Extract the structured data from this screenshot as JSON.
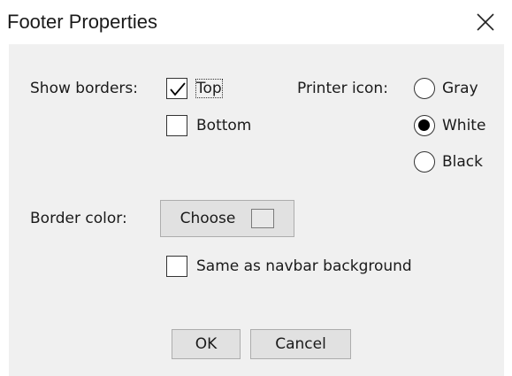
{
  "window": {
    "title": "Footer Properties",
    "close_icon": "close-icon"
  },
  "borders": {
    "label": "Show borders:",
    "top": {
      "label": "Top",
      "checked": true
    },
    "bottom": {
      "label": "Bottom",
      "checked": false
    }
  },
  "printer_icon": {
    "label": "Printer icon:",
    "options": [
      {
        "label": "Gray",
        "selected": false
      },
      {
        "label": "White",
        "selected": true
      },
      {
        "label": "Black",
        "selected": false
      }
    ]
  },
  "border_color": {
    "label": "Border color:",
    "choose_label": "Choose",
    "swatch_color": "#e8e8e8"
  },
  "same_as_navbar": {
    "label": "Same as navbar background",
    "checked": false
  },
  "buttons": {
    "ok": "OK",
    "cancel": "Cancel"
  }
}
